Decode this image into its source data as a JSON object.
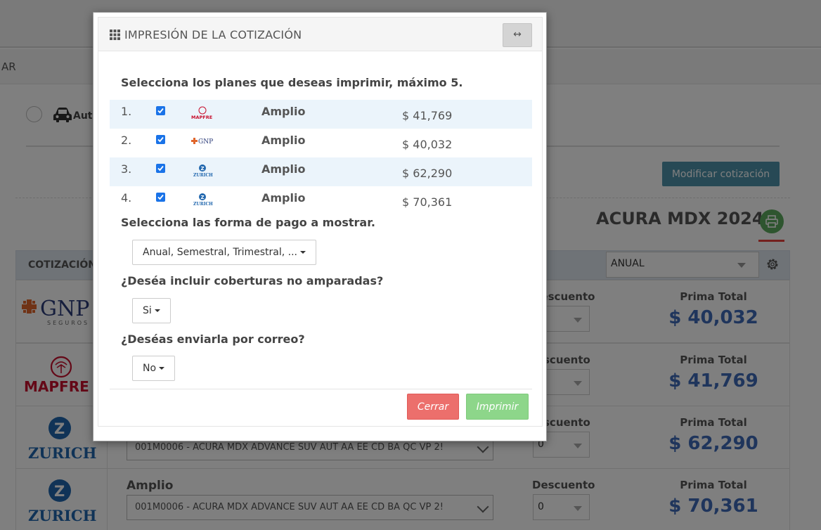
{
  "background": {
    "nav_text": "AR",
    "car_option_label": "Aut",
    "modify_button": "Modificar cotización",
    "vehicle_title": "ACURA MDX 2024",
    "table_header": "COTIZACIÓN",
    "frequency_select": "ANUAL",
    "quotes": [
      {
        "insurer": "GNP",
        "insurer_sub": "SEGUROS",
        "discount_label": "Descuento",
        "prima_label": "Prima Total",
        "prima": "$ 40,032"
      },
      {
        "insurer": "MAPFRE",
        "discount_label": "scuento",
        "prima_label": "Prima Total",
        "prima": "$ 41,769"
      },
      {
        "insurer": "ZURICH",
        "discount_label": "scuento",
        "discount_value": "0",
        "plan_value": "001M0006 - ACURA MDX ADVANCE SUV AUT AA EE CD BA QC VP 2!",
        "prima_label": "Prima Total",
        "prima": "$ 62,290"
      },
      {
        "insurer": "ZURICH",
        "plan_label": "Amplio",
        "discount_label": "Descuento",
        "discount_value": "0",
        "plan_value": "001M0006 - ACURA MDX ADVANCE SUV AUT AA EE CD BA QC VP 2!",
        "prima_label": "Prima Total",
        "prima": "$ 70,361"
      }
    ]
  },
  "modal": {
    "title": "IMPRESIÓN DE LA COTIZACIÓN",
    "expand_glyph": "↔",
    "plans_prompt": "Selecciona los planes que deseas imprimir, máximo 5.",
    "plans": [
      {
        "number": "1.",
        "insurer": "MAPFRE",
        "name": "Amplio",
        "price": "$ 41,769",
        "checked": true
      },
      {
        "number": "2.",
        "insurer": "GNP",
        "name": "Amplio",
        "price": "$ 40,032",
        "checked": true
      },
      {
        "number": "3.",
        "insurer": "ZURICH",
        "name": "Amplio",
        "price": "$ 62,290",
        "checked": true
      },
      {
        "number": "4.",
        "insurer": "ZURICH",
        "name": "Amplio",
        "price": "$ 70,361",
        "checked": true
      }
    ],
    "payment_prompt": "Selecciona las forma de pago a mostrar.",
    "payment_value": "Anual, Semestral, Trimestral, ...",
    "coverage_prompt": "¿Deséa incluir coberturas no amparadas?",
    "coverage_value": "Si",
    "email_prompt": "¿Deséas enviarla por correo?",
    "email_value": "No",
    "close_button": "Cerrar",
    "print_button": "Imprimir"
  },
  "colors": {
    "accent_blue": "#3e6bb8",
    "modify_button": "#4f93aa",
    "print_green": "#5dab5f",
    "close_red": "#ec6f6c",
    "imprimir_green": "#8dd68a"
  }
}
